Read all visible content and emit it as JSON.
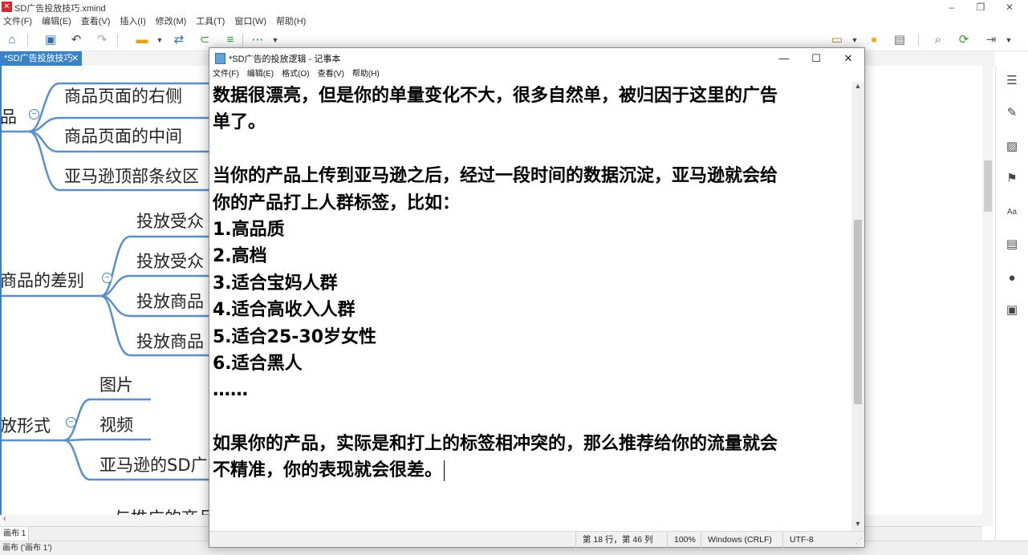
{
  "xmind": {
    "window_title": "SD广告投放技巧.xmind",
    "menu": [
      "文件(F)",
      "编辑(E)",
      "查看(V)",
      "插入(I)",
      "修改(M)",
      "工具(T)",
      "窗口(W)",
      "帮助(H)"
    ],
    "tab_label": "*SD广告投放技巧",
    "tab_close": "✕",
    "mindmap": {
      "groups": [
        {
          "parent": "品",
          "children": [
            "商品页面的右侧",
            "商品页面的中间",
            "亚马逊顶部条纹区"
          ]
        },
        {
          "parent": "商品的差别",
          "children": [
            "投放受众",
            "投放受众",
            "投放商品",
            "投放商品"
          ]
        },
        {
          "parent": "放形式",
          "children": [
            "图片",
            "视频",
            "亚马逊的SD广"
          ]
        }
      ],
      "partial_bottom": "与推广的商品"
    },
    "sheet_tab": "画布 1",
    "status": "画布 ('画布 1')"
  },
  "notepad": {
    "title": "*SD广告的投放逻辑 - 记事本",
    "menu": [
      "文件(F)",
      "编辑(E)",
      "格式(O)",
      "查看(V)",
      "帮助(H)"
    ],
    "lines": [
      "数据很漂亮，但是你的单量变化不大，很多自然单，被归因于这里的广告",
      "单了。",
      "",
      "当你的产品上传到亚马逊之后，经过一段时间的数据沉淀，亚马逊就会给",
      "你的产品打上人群标签，比如：",
      "1.高品质",
      "2.高档",
      "3.适合宝妈人群",
      "4.适合高收入人群",
      "5.适合25-30岁女性",
      "6.适合黑人",
      "……",
      "",
      "如果你的产品，实际是和打上的标签相冲突的，那么推荐给你的流量就会",
      "不精准，你的表现就会很差。"
    ],
    "status": {
      "position": "第 18 行，第 46 列",
      "zoom": "100%",
      "line_ending": "Windows (CRLF)",
      "encoding": "UTF-8"
    }
  }
}
